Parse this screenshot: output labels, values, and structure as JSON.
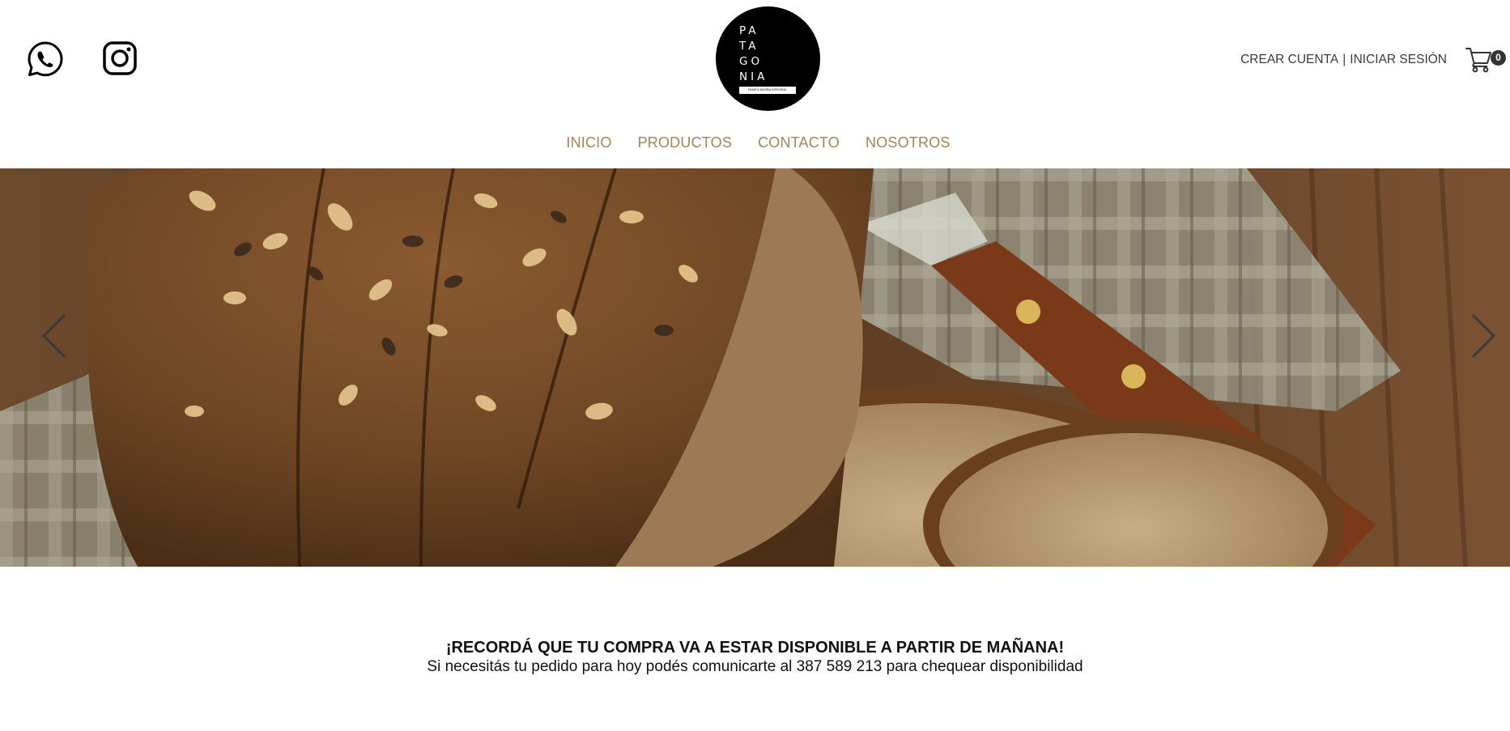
{
  "header": {
    "social": [
      {
        "icon": "whatsapp-icon"
      },
      {
        "icon": "instagram-icon"
      }
    ],
    "logo": {
      "lines": [
        "PA",
        "TA",
        "GO",
        "NIA"
      ],
      "tagline": "PANIFICADORA INTEGRAL"
    },
    "account": {
      "create_label": "CREAR CUENTA",
      "separator": "|",
      "login_label": "INICIAR SESIÓN"
    },
    "cart": {
      "icon": "cart-icon",
      "count": "0"
    }
  },
  "nav": {
    "items": [
      {
        "label": "INICIO"
      },
      {
        "label": "PRODUCTOS"
      },
      {
        "label": "CONTACTO"
      },
      {
        "label": "NOSOTROS"
      }
    ]
  },
  "hero": {
    "prev_icon": "chevron-left-icon",
    "next_icon": "chevron-right-icon"
  },
  "notice": {
    "title": "¡RECORDÁ QUE TU COMPRA VA A ESTAR DISPONIBLE A PARTIR DE MAÑANA!",
    "subtitle": "Si necesitás tu pedido para hoy podés comunicarte al 387 589 213 para chequear disponibilidad"
  },
  "colors": {
    "nav_text": "#a38457",
    "logo_bg": "#000000",
    "badge_bg": "#333333"
  }
}
